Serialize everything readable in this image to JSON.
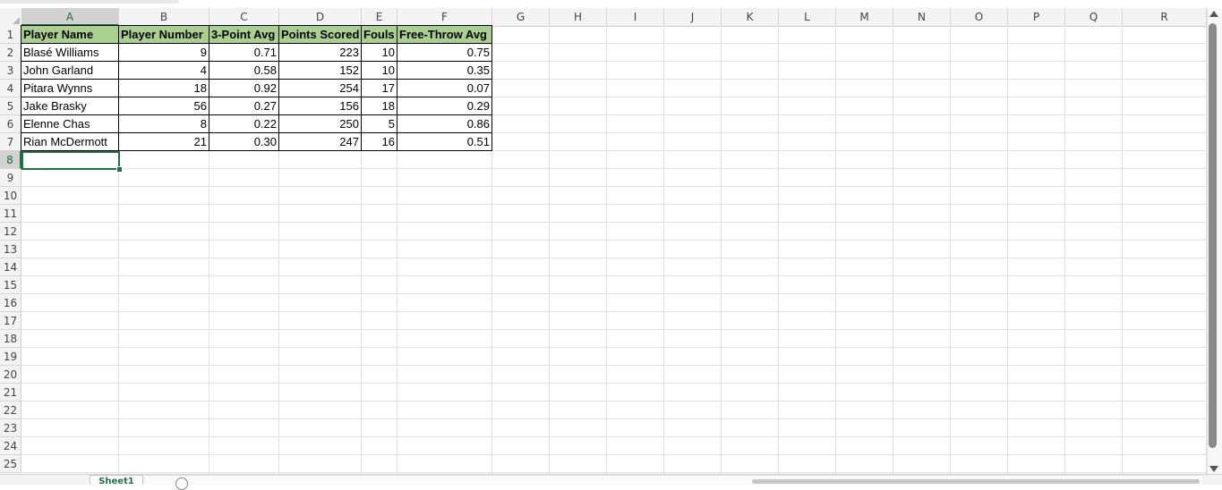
{
  "columns": [
    "A",
    "B",
    "C",
    "D",
    "E",
    "F",
    "G",
    "H",
    "I",
    "J",
    "K",
    "L",
    "M",
    "N",
    "O",
    "P",
    "Q",
    "R"
  ],
  "rows": [
    "1",
    "2",
    "3",
    "4",
    "5",
    "6",
    "7",
    "8",
    "9",
    "10",
    "11",
    "12",
    "13",
    "14",
    "15",
    "16",
    "17",
    "18",
    "19",
    "20",
    "21",
    "22",
    "23",
    "24",
    "25"
  ],
  "selected_cell": "A8",
  "table": {
    "headers": [
      "Player Name",
      "Player Number",
      "3-Point Avg",
      "Points Scored",
      "Fouls",
      "Free-Throw Avg"
    ],
    "records": [
      [
        "Blasé Williams",
        "9",
        "0.71",
        "223",
        "10",
        "0.75"
      ],
      [
        "John Garland",
        "4",
        "0.58",
        "152",
        "10",
        "0.35"
      ],
      [
        "Pitara Wynns",
        "18",
        "0.92",
        "254",
        "17",
        "0.07"
      ],
      [
        "Jake Brasky",
        "56",
        "0.27",
        "156",
        "18",
        "0.29"
      ],
      [
        "Elenne Chas",
        "8",
        "0.22",
        "250",
        "5",
        "0.86"
      ],
      [
        "Rian McDermott",
        "21",
        "0.30",
        "247",
        "16",
        "0.51"
      ]
    ]
  },
  "sheet_tab": {
    "label": "Sheet1"
  },
  "colors": {
    "header_fill": "#a9d08e",
    "selection": "#1e7145"
  }
}
